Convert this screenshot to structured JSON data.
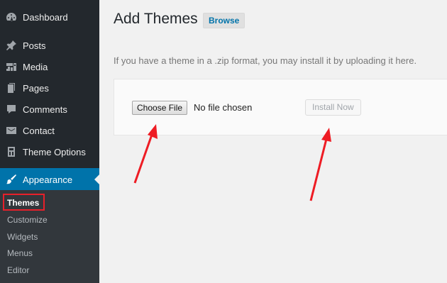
{
  "sidebar": {
    "items": [
      {
        "label": "Dashboard",
        "icon": "dashboard-icon"
      },
      {
        "label": "Posts",
        "icon": "pin-icon"
      },
      {
        "label": "Media",
        "icon": "media-icon"
      },
      {
        "label": "Pages",
        "icon": "pages-icon"
      },
      {
        "label": "Comments",
        "icon": "comments-icon"
      },
      {
        "label": "Contact",
        "icon": "mail-icon"
      },
      {
        "label": "Theme Options",
        "icon": "theme-options-icon"
      },
      {
        "label": "Appearance",
        "icon": "brush-icon"
      }
    ],
    "submenu": [
      "Themes",
      "Customize",
      "Widgets",
      "Menus",
      "Editor"
    ]
  },
  "main": {
    "title": "Add Themes",
    "browse_label": "Browse",
    "help_text": "If you have a theme in a .zip format, you may install it by uploading it here.",
    "choose_file_label": "Choose File",
    "no_file_text": "No file chosen",
    "install_label": "Install Now"
  },
  "colors": {
    "sidebar_bg": "#23282d",
    "active_bg": "#0073aa",
    "highlight": "#e8202a"
  }
}
